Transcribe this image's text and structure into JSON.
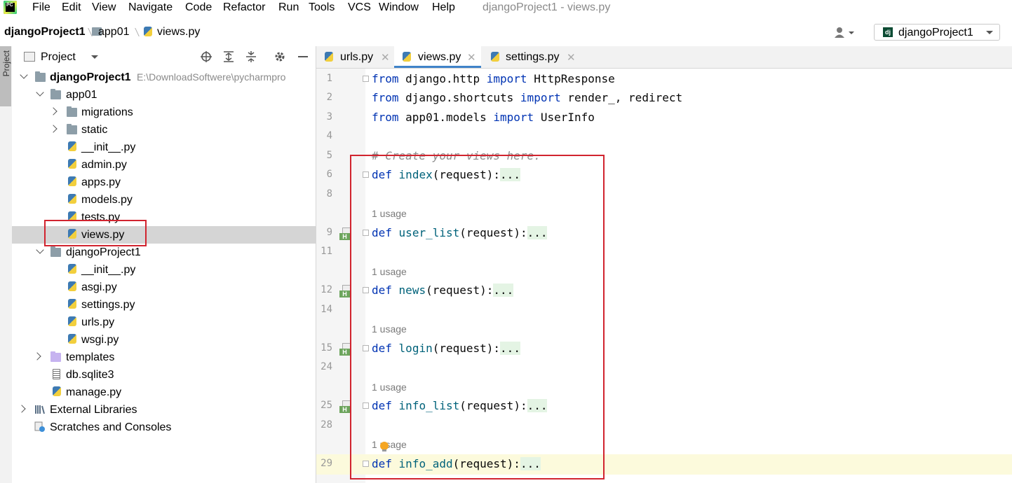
{
  "menubar": {
    "items": [
      "File",
      "Edit",
      "View",
      "Navigate",
      "Code",
      "Refactor",
      "Run",
      "Tools",
      "VCS",
      "Window",
      "Help"
    ],
    "window_title": "djangoProject1 - views.py"
  },
  "navbar": {
    "crumbs": [
      "djangoProject1",
      "app01",
      "views.py"
    ],
    "run_config": "djangoProject1"
  },
  "project_panel": {
    "title": "Project",
    "stripe_label": "Project",
    "tree": [
      {
        "label": "djangoProject1",
        "path": "E:\\DownloadSoftwere\\pycharmpro"
      },
      {
        "label": "app01"
      },
      {
        "label": "migrations"
      },
      {
        "label": "static"
      },
      {
        "label": "__init__.py"
      },
      {
        "label": "admin.py"
      },
      {
        "label": "apps.py"
      },
      {
        "label": "models.py"
      },
      {
        "label": "tests.py"
      },
      {
        "label": "views.py"
      },
      {
        "label": "djangoProject1"
      },
      {
        "label": "__init__.py"
      },
      {
        "label": "asgi.py"
      },
      {
        "label": "settings.py"
      },
      {
        "label": "urls.py"
      },
      {
        "label": "wsgi.py"
      },
      {
        "label": "templates"
      },
      {
        "label": "db.sqlite3"
      },
      {
        "label": "manage.py"
      },
      {
        "label": "External Libraries"
      },
      {
        "label": "Scratches and Consoles"
      }
    ]
  },
  "tabs": [
    "urls.py",
    "views.py",
    "settings.py"
  ],
  "editor": {
    "line_numbers": [
      "1",
      "2",
      "3",
      "4",
      "5",
      "6",
      "8",
      "9",
      "11",
      "12",
      "14",
      "15",
      "24",
      "25",
      "28",
      "29"
    ],
    "code": {
      "l1_kw1": "from",
      "l1_mod": " django.http ",
      "l1_kw2": "import",
      "l1_name": " HttpResponse",
      "l2_kw1": "from",
      "l2_mod": " django.shortcuts ",
      "l2_kw2": "import",
      "l2_name": " render_, redirect",
      "l3_kw1": "from",
      "l3_mod": " app01.models ",
      "l3_kw2": "import",
      "l3_name": " UserInfo",
      "comment": "# Create your views here.",
      "def": "def",
      "fold": "...",
      "functions": [
        "index",
        "user_list",
        "news",
        "login",
        "info_list",
        "info_add"
      ],
      "params": "(request):"
    },
    "usage_hint": "1 usage",
    "gutter_badge": "H"
  },
  "colors": {
    "keyword": "#0033b3",
    "function": "#00627a",
    "highlight_box": "#d1242f",
    "active_tab": "#4083c9"
  }
}
